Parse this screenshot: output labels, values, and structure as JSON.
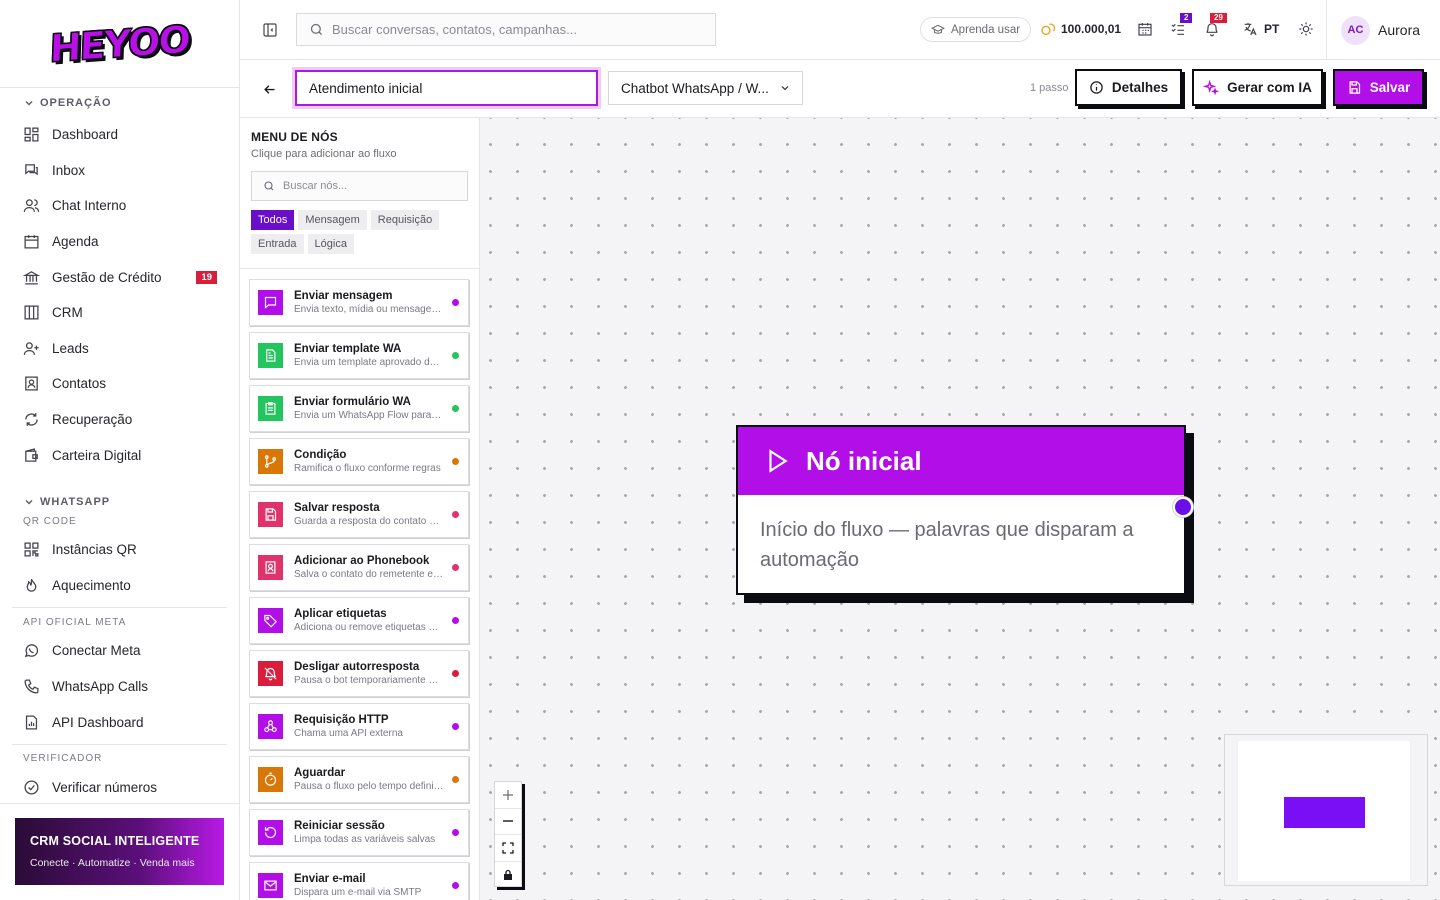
{
  "brand": {
    "logo_text": "HEYOO"
  },
  "sidebar": {
    "sections": [
      {
        "title": "OPERAÇÃO",
        "items": [
          {
            "label": "Dashboard",
            "icon": "grid-icon"
          },
          {
            "label": "Inbox",
            "icon": "chat-icon"
          },
          {
            "label": "Chat Interno",
            "icon": "users-icon"
          },
          {
            "label": "Agenda",
            "icon": "calendar-icon"
          },
          {
            "label": "Gestão de Crédito",
            "icon": "bank-icon",
            "badge": "19"
          },
          {
            "label": "CRM",
            "icon": "columns-icon"
          },
          {
            "label": "Leads",
            "icon": "user-plus-icon"
          },
          {
            "label": "Contatos",
            "icon": "contact-icon"
          },
          {
            "label": "Recuperação",
            "icon": "refresh-icon"
          },
          {
            "label": "Carteira Digital",
            "icon": "wallet-icon"
          }
        ]
      },
      {
        "title": "WHATSAPP",
        "subtitle": "QR CODE",
        "items": [
          {
            "label": "Instâncias QR",
            "icon": "qr-icon"
          },
          {
            "label": "Aquecimento",
            "icon": "flame-icon"
          }
        ]
      },
      {
        "subtitle": "API OFICIAL META",
        "items": [
          {
            "label": "Conectar Meta",
            "icon": "whatsapp-icon"
          },
          {
            "label": "WhatsApp Calls",
            "icon": "phone-icon"
          },
          {
            "label": "API Dashboard",
            "icon": "doc-chart-icon"
          }
        ]
      },
      {
        "subtitle": "VERIFICADOR",
        "items": [
          {
            "label": "Verificar números",
            "icon": "check-circle-icon"
          }
        ]
      }
    ],
    "promo": {
      "title": "CRM SOCIAL INTELIGENTE",
      "subtitle": "Conecte · Automatize · Venda mais"
    }
  },
  "topbar": {
    "search_placeholder": "Buscar conversas, contatos, campanhas...",
    "learn_label": "Aprenda usar",
    "credits": "100.000,01",
    "tasks_badge": "2",
    "notifications_badge": "29",
    "language": "PT",
    "user": {
      "initials": "AC",
      "name": "Aurora"
    }
  },
  "flow": {
    "name": "Atendimento inicial",
    "type": "Chatbot WhatsApp / W...",
    "steps": "1 passo",
    "buttons": {
      "details": "Detalhes",
      "generate": "Gerar com IA",
      "save": "Salvar"
    }
  },
  "node_menu": {
    "title": "MENU DE NÓS",
    "subtitle": "Clique para adicionar ao fluxo",
    "search_placeholder": "Buscar nós...",
    "filters": [
      "Todos",
      "Mensagem",
      "Requisição",
      "Entrada",
      "Lógica"
    ],
    "active_filter": "Todos",
    "nodes": [
      {
        "title": "Enviar mensagem",
        "desc": "Envia texto, mídia ou mensagens ...",
        "color": "#b10ee8",
        "icon": "message-icon",
        "dot": "#b10ee8"
      },
      {
        "title": "Enviar template WA",
        "desc": "Envia um template aprovado do ...",
        "color": "#22c55e",
        "icon": "file-text-icon",
        "dot": "#22c55e"
      },
      {
        "title": "Enviar formulário WA",
        "desc": "Envia um WhatsApp Flow para c...",
        "color": "#22c55e",
        "icon": "clipboard-icon",
        "dot": "#22c55e"
      },
      {
        "title": "Condição",
        "desc": "Ramifica o fluxo conforme regras",
        "color": "#d97706",
        "icon": "branch-icon",
        "dot": "#d97706"
      },
      {
        "title": "Salvar resposta",
        "desc": "Guarda a resposta do contato nu...",
        "color": "#e0336b",
        "icon": "save-icon",
        "dot": "#e0336b"
      },
      {
        "title": "Adicionar ao Phonebook",
        "desc": "Salva o contato do remetente em...",
        "color": "#e0336b",
        "icon": "contact-book-icon",
        "dot": "#e0336b"
      },
      {
        "title": "Aplicar etiquetas",
        "desc": "Adiciona ou remove etiquetas da...",
        "color": "#b10ee8",
        "icon": "tag-icon",
        "dot": "#b10ee8"
      },
      {
        "title": "Desligar autorresposta",
        "desc": "Pausa o bot temporariamente pa...",
        "color": "#d81e3a",
        "icon": "bell-off-icon",
        "dot": "#d81e3a"
      },
      {
        "title": "Requisição HTTP",
        "desc": "Chama uma API externa",
        "color": "#b10ee8",
        "icon": "webhook-icon",
        "dot": "#b10ee8"
      },
      {
        "title": "Aguardar",
        "desc": "Pausa o fluxo pelo tempo definido",
        "color": "#d97706",
        "icon": "timer-icon",
        "dot": "#d97706"
      },
      {
        "title": "Reiniciar sessão",
        "desc": "Limpa todas as variáveis salvas",
        "color": "#b10ee8",
        "icon": "restart-icon",
        "dot": "#b10ee8"
      },
      {
        "title": "Enviar e-mail",
        "desc": "Dispara um e-mail via SMTP",
        "color": "#b10ee8",
        "icon": "mail-icon",
        "dot": "#b10ee8"
      }
    ]
  },
  "canvas": {
    "start_node": {
      "title": "Nó inicial",
      "description": "Início do fluxo — palavras que disparam a automação"
    }
  },
  "colors": {
    "primary": "#b10ee8",
    "accent_dark": "#6a0fc8",
    "border": "#0b0b12"
  }
}
